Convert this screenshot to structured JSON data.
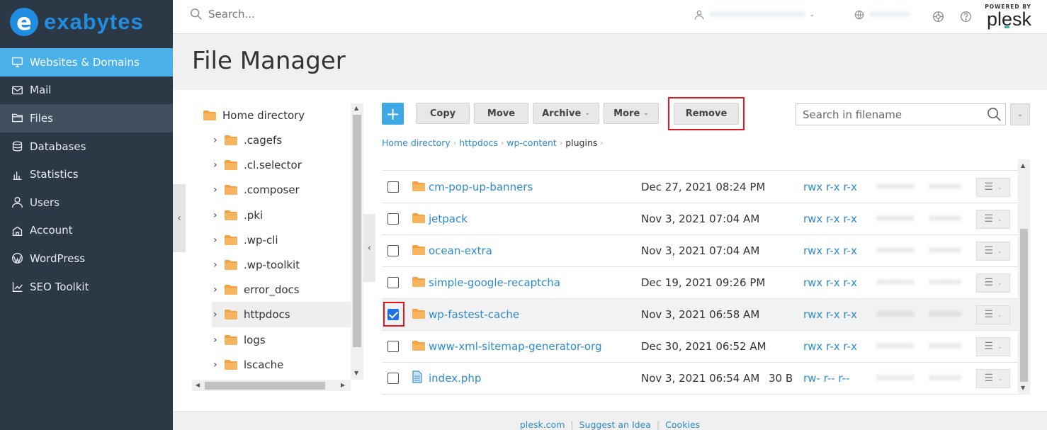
{
  "brand": {
    "name": "exabytes",
    "badge": "e",
    "color": "#1f8ee0"
  },
  "sidebar": {
    "items": [
      {
        "label": "Websites & Domains",
        "icon": "monitor-icon",
        "state": "active"
      },
      {
        "label": "Mail",
        "icon": "mail-icon",
        "state": ""
      },
      {
        "label": "Files",
        "icon": "folder-icon",
        "state": "selected"
      },
      {
        "label": "Databases",
        "icon": "database-icon",
        "state": ""
      },
      {
        "label": "Statistics",
        "icon": "bar-chart-icon",
        "state": ""
      },
      {
        "label": "Users",
        "icon": "user-icon",
        "state": ""
      },
      {
        "label": "Account",
        "icon": "account-icon",
        "state": ""
      },
      {
        "label": "WordPress",
        "icon": "wordpress-icon",
        "state": ""
      },
      {
        "label": "SEO Toolkit",
        "icon": "seo-chart-icon",
        "state": ""
      }
    ]
  },
  "topbar": {
    "search_placeholder": "Search...",
    "user_name": "•••••••••••••••••••",
    "subscription": "••••••••"
  },
  "plesk": {
    "powered_by": "POWERED BY",
    "name": "plesk"
  },
  "page": {
    "title": "File Manager"
  },
  "tree": {
    "root": "Home directory",
    "items": [
      ".cagefs",
      ".cl.selector",
      ".composer",
      ".pki",
      ".wp-cli",
      ".wp-toolkit",
      "error_docs",
      "httpdocs",
      "logs",
      "lscache"
    ],
    "selected": "httpdocs"
  },
  "toolbar": {
    "add": "+",
    "copy": "Copy",
    "move": "Move",
    "archive": "Archive",
    "more": "More",
    "remove": "Remove",
    "search_placeholder": "Search in filename"
  },
  "breadcrumb": [
    "Home directory",
    "httpdocs",
    "wp-content",
    "plugins"
  ],
  "files": [
    {
      "name": "cm-pop-up-banners",
      "type": "folder",
      "date": "Dec 27, 2021 08:24 PM",
      "size": "",
      "perm": "rwx r-x r-x",
      "owner": "•••••••",
      "group": "••••••",
      "checked": false
    },
    {
      "name": "jetpack",
      "type": "folder",
      "date": "Nov 3, 2021 07:04 AM",
      "size": "",
      "perm": "rwx r-x r-x",
      "owner": "•••••••",
      "group": "••••••",
      "checked": false
    },
    {
      "name": "ocean-extra",
      "type": "folder",
      "date": "Nov 3, 2021 07:04 AM",
      "size": "",
      "perm": "rwx r-x r-x",
      "owner": "•••••••",
      "group": "••••••",
      "checked": false
    },
    {
      "name": "simple-google-recaptcha",
      "type": "folder",
      "date": "Dec 19, 2021 09:26 PM",
      "size": "",
      "perm": "rwx r-x r-x",
      "owner": "•••••••",
      "group": "••••••",
      "checked": false
    },
    {
      "name": "wp-fastest-cache",
      "type": "folder",
      "date": "Nov 3, 2021 06:58 AM",
      "size": "",
      "perm": "rwx r-x r-x",
      "owner": "•••••••",
      "group": "••••••",
      "checked": true
    },
    {
      "name": "www-xml-sitemap-generator-org",
      "type": "folder",
      "date": "Dec 30, 2021 06:52 AM",
      "size": "",
      "perm": "rwx r-x r-x",
      "owner": "•••••••",
      "group": "••••••",
      "checked": false
    },
    {
      "name": "index.php",
      "type": "file",
      "date": "Nov 3, 2021 06:54 AM",
      "size": "30 B",
      "perm": "rw- r-- r--",
      "owner": "•••••••",
      "group": "••••••",
      "checked": false
    }
  ],
  "footer": {
    "links": [
      "plesk.com",
      "Suggest an Idea",
      "Cookies"
    ]
  },
  "colors": {
    "accent": "#4ab0e8",
    "link": "#2c8bd0",
    "highlight": "#e3161e",
    "folder": "#f5a142"
  }
}
